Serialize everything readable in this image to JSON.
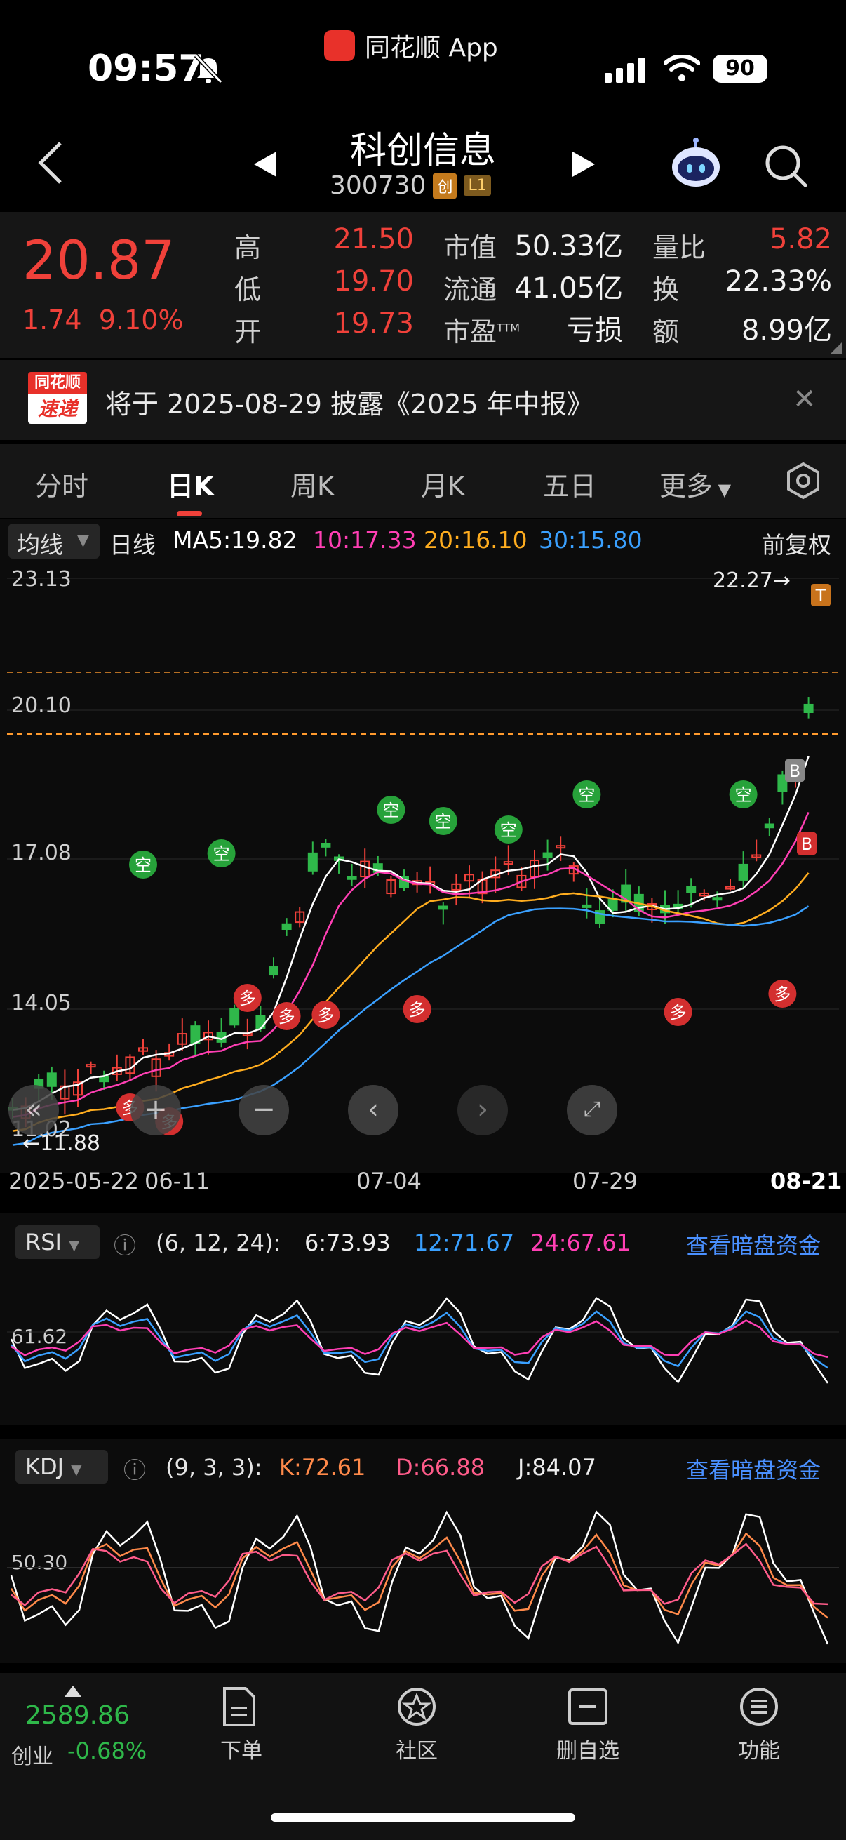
{
  "status": {
    "time": "09:57",
    "app": "同花顺 App",
    "battery": "90"
  },
  "header": {
    "name": "科创信息",
    "code": "300730",
    "tag1": "创",
    "tag2": "L1"
  },
  "quote": {
    "price": "20.87",
    "change": "1.74",
    "pct": "9.10%",
    "high_lbl": "高",
    "high": "21.50",
    "low_lbl": "低",
    "low": "19.70",
    "open_lbl": "开",
    "open": "19.73",
    "mcap_lbl": "市值",
    "mcap": "50.33亿",
    "float_lbl": "流通",
    "float": "41.05亿",
    "pe_lbl": "市盈",
    "pe_sup": "TTM",
    "pe": "亏损",
    "vr_lbl": "量比",
    "vr": "5.82",
    "turn_lbl": "换",
    "turn": "22.33%",
    "amt_lbl": "额",
    "amt": "8.99亿"
  },
  "news": {
    "logo_top": "同花顺",
    "logo_bottom": "速递",
    "text": "将于 2025-08-29 披露《2025 年中报》"
  },
  "tabs": [
    "分时",
    "日K",
    "周K",
    "月K",
    "五日",
    "更多"
  ],
  "ma": {
    "select": "均线",
    "period": "日线",
    "ma5": "MA5:19.82",
    "ma10": "10:17.33",
    "ma20": "20:16.10",
    "ma30": "30:15.80",
    "adjust": "前复权"
  },
  "axis": {
    "y1": "23.13",
    "y2": "20.10",
    "y3": "17.08",
    "y4": "14.05",
    "y5": "11.02",
    "low_mark": "←11.88",
    "high_mark": "22.27→"
  },
  "dates": [
    "2025-05-22",
    "06-11",
    "07-04",
    "07-29",
    "08-21"
  ],
  "rsi": {
    "select": "RSI",
    "params": "(6, 12, 24):",
    "v6": "6:73.93",
    "v12": "12:71.67",
    "v24": "24:67.61",
    "link": "查看暗盘资金",
    "axis": "61.62"
  },
  "kdj": {
    "select": "KDJ",
    "params": "(9, 3, 3):",
    "k": "K:72.61",
    "d": "D:66.88",
    "j": "J:84.07",
    "link": "查看暗盘资金",
    "axis": "50.30"
  },
  "signals": {
    "kong": "空",
    "duo": "多",
    "buy": "B",
    "top": "T"
  },
  "bottom": {
    "index_value": "2589.86",
    "index_name": "创业",
    "index_pct": "-0.68%",
    "order": "下单",
    "community": "社区",
    "remove": "删自选",
    "function": "功能"
  },
  "colors": {
    "red": "#f0413a",
    "green": "#2fb84a",
    "ma5": "#ffffff",
    "ma10": "#ff3fb4",
    "ma20": "#ffad1f",
    "ma30": "#3aa0ff",
    "link": "#4a90ff"
  }
}
